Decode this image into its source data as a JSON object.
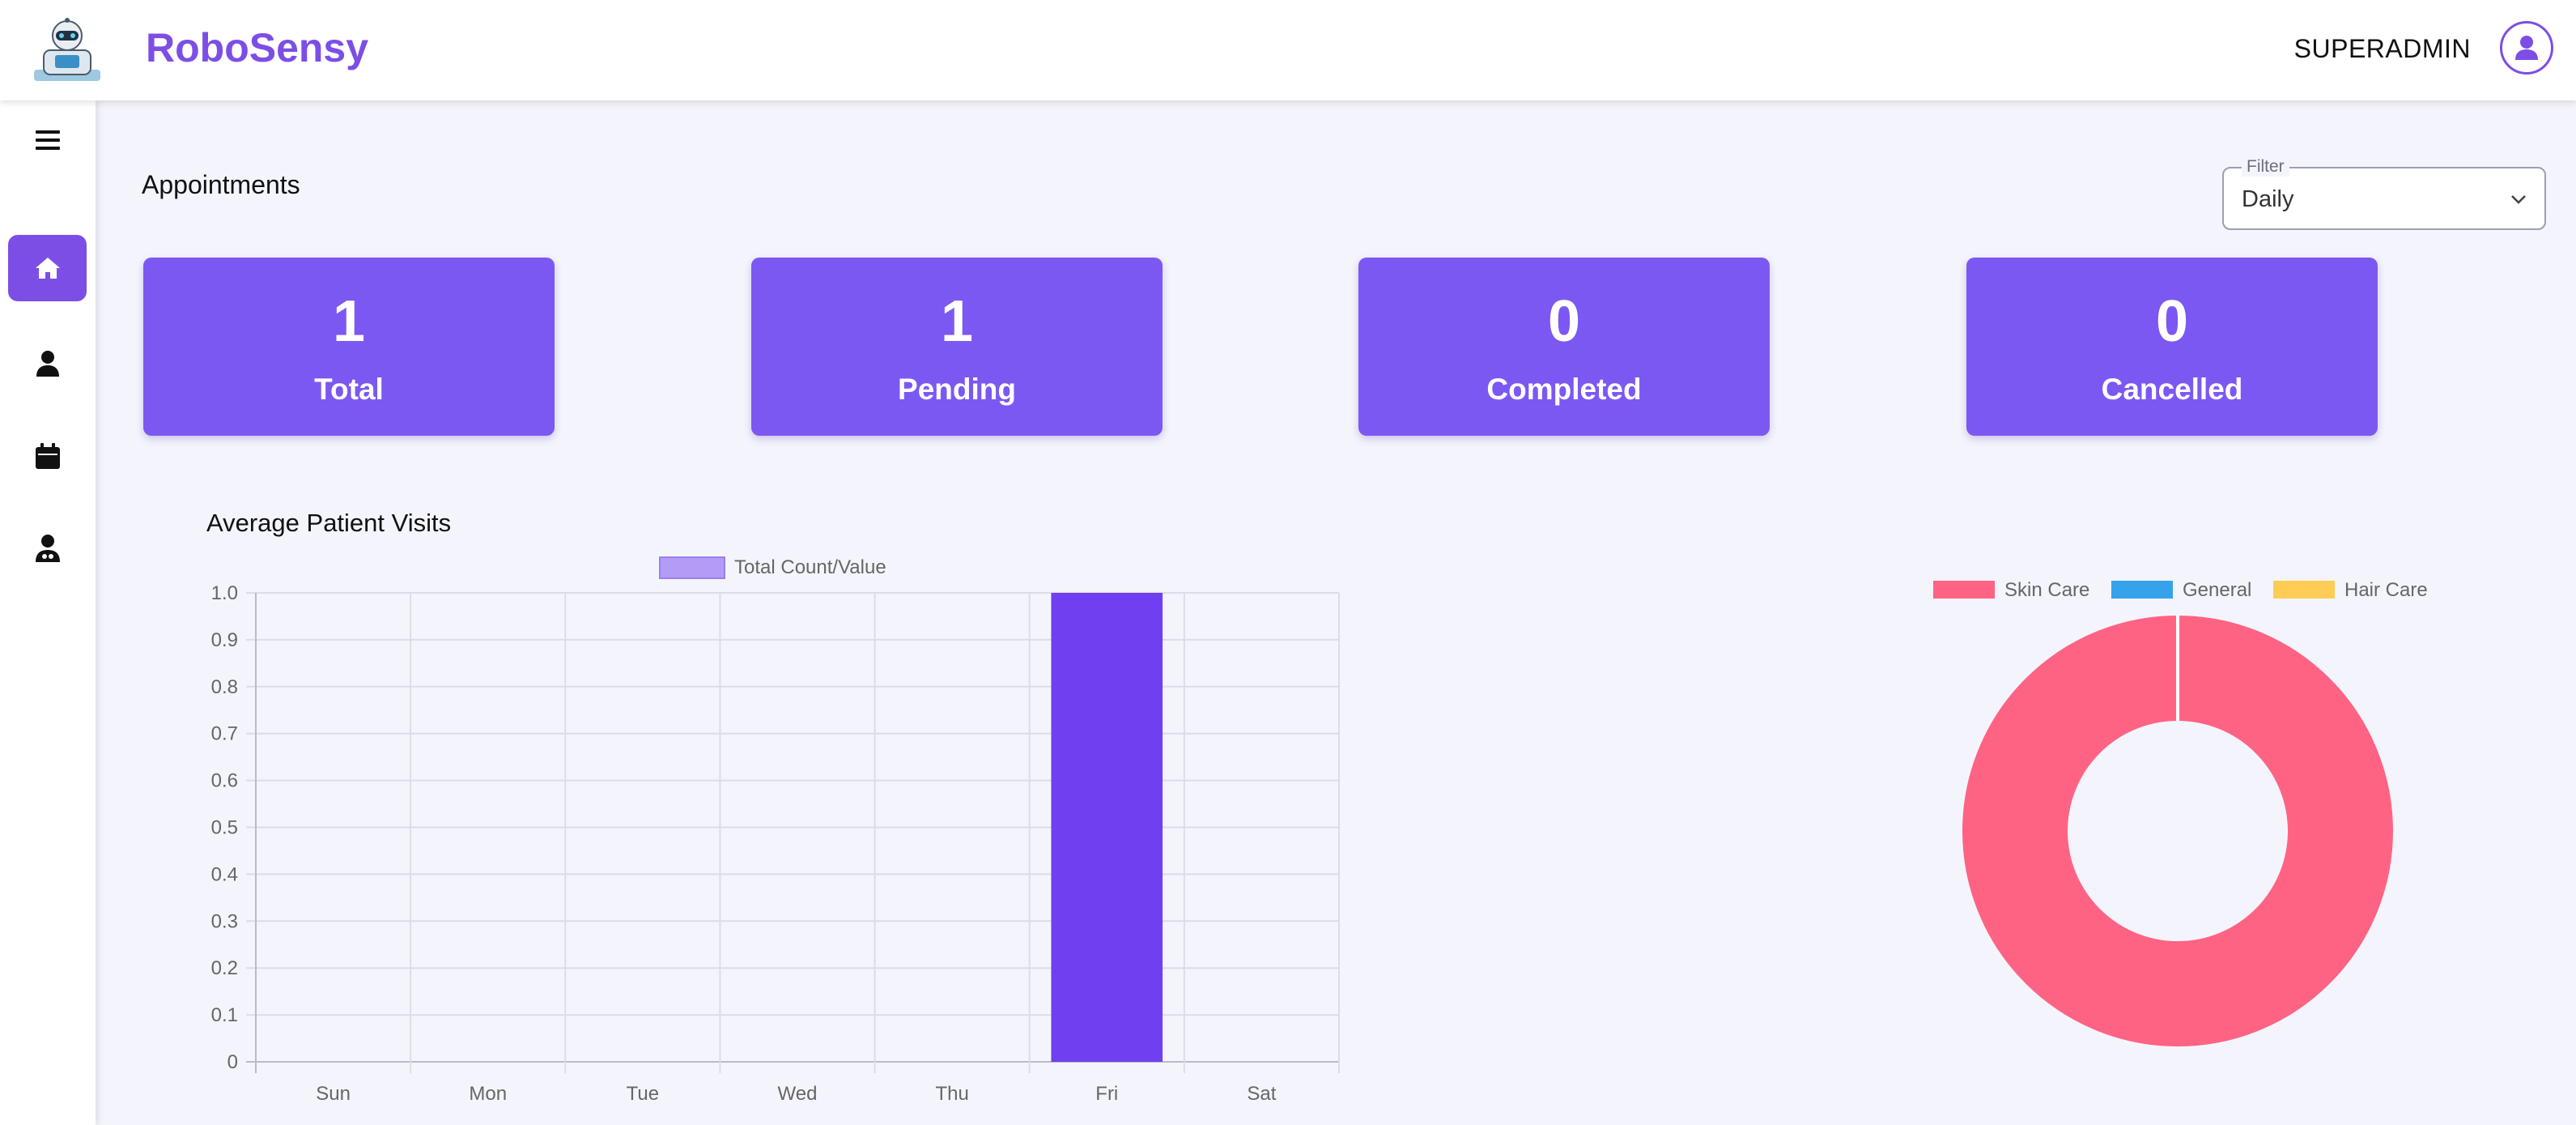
{
  "header": {
    "brand": "RoboSensy",
    "user_name": "SUPERADMIN",
    "logo_icon": "robot-logo-icon",
    "avatar_icon": "user-avatar-icon"
  },
  "sidebar": {
    "items": [
      {
        "icon": "hamburger-menu-icon",
        "active": false
      },
      {
        "icon": "home-icon",
        "active": true
      },
      {
        "icon": "user-icon",
        "active": false
      },
      {
        "icon": "calendar-icon",
        "active": false
      },
      {
        "icon": "doctor-icon",
        "active": false
      }
    ]
  },
  "main": {
    "section_title": "Appointments",
    "filter": {
      "label": "Filter",
      "value": "Daily"
    },
    "cards": [
      {
        "value": "1",
        "label": "Total"
      },
      {
        "value": "1",
        "label": "Pending"
      },
      {
        "value": "0",
        "label": "Completed"
      },
      {
        "value": "0",
        "label": "Cancelled"
      }
    ],
    "chart_title": "Average Patient Visits"
  },
  "colors": {
    "accent": "#7c4ee6",
    "card": "#7c58f2",
    "bar": "#6f3ff0",
    "bar_legend": "#b39cf5",
    "skin_care": "#ff6384",
    "general": "#36a2eb",
    "hair_care": "#ffcd56"
  },
  "chart_data": [
    {
      "type": "bar",
      "categories": [
        "Sun",
        "Mon",
        "Tue",
        "Wed",
        "Thu",
        "Fri",
        "Sat"
      ],
      "series": [
        {
          "name": "Total Count/Value",
          "values": [
            0,
            0,
            0,
            0,
            0,
            1,
            0
          ]
        }
      ],
      "ylim": [
        0,
        1
      ],
      "yticks": [
        "0",
        "0.1",
        "0.2",
        "0.3",
        "0.4",
        "0.5",
        "0.6",
        "0.7",
        "0.8",
        "0.9",
        "1.0"
      ],
      "grid": true,
      "legend": "top-center"
    },
    {
      "type": "pie",
      "labels": [
        "Skin Care",
        "General",
        "Hair Care"
      ],
      "values": [
        1,
        0,
        0
      ],
      "legend": "top"
    }
  ]
}
